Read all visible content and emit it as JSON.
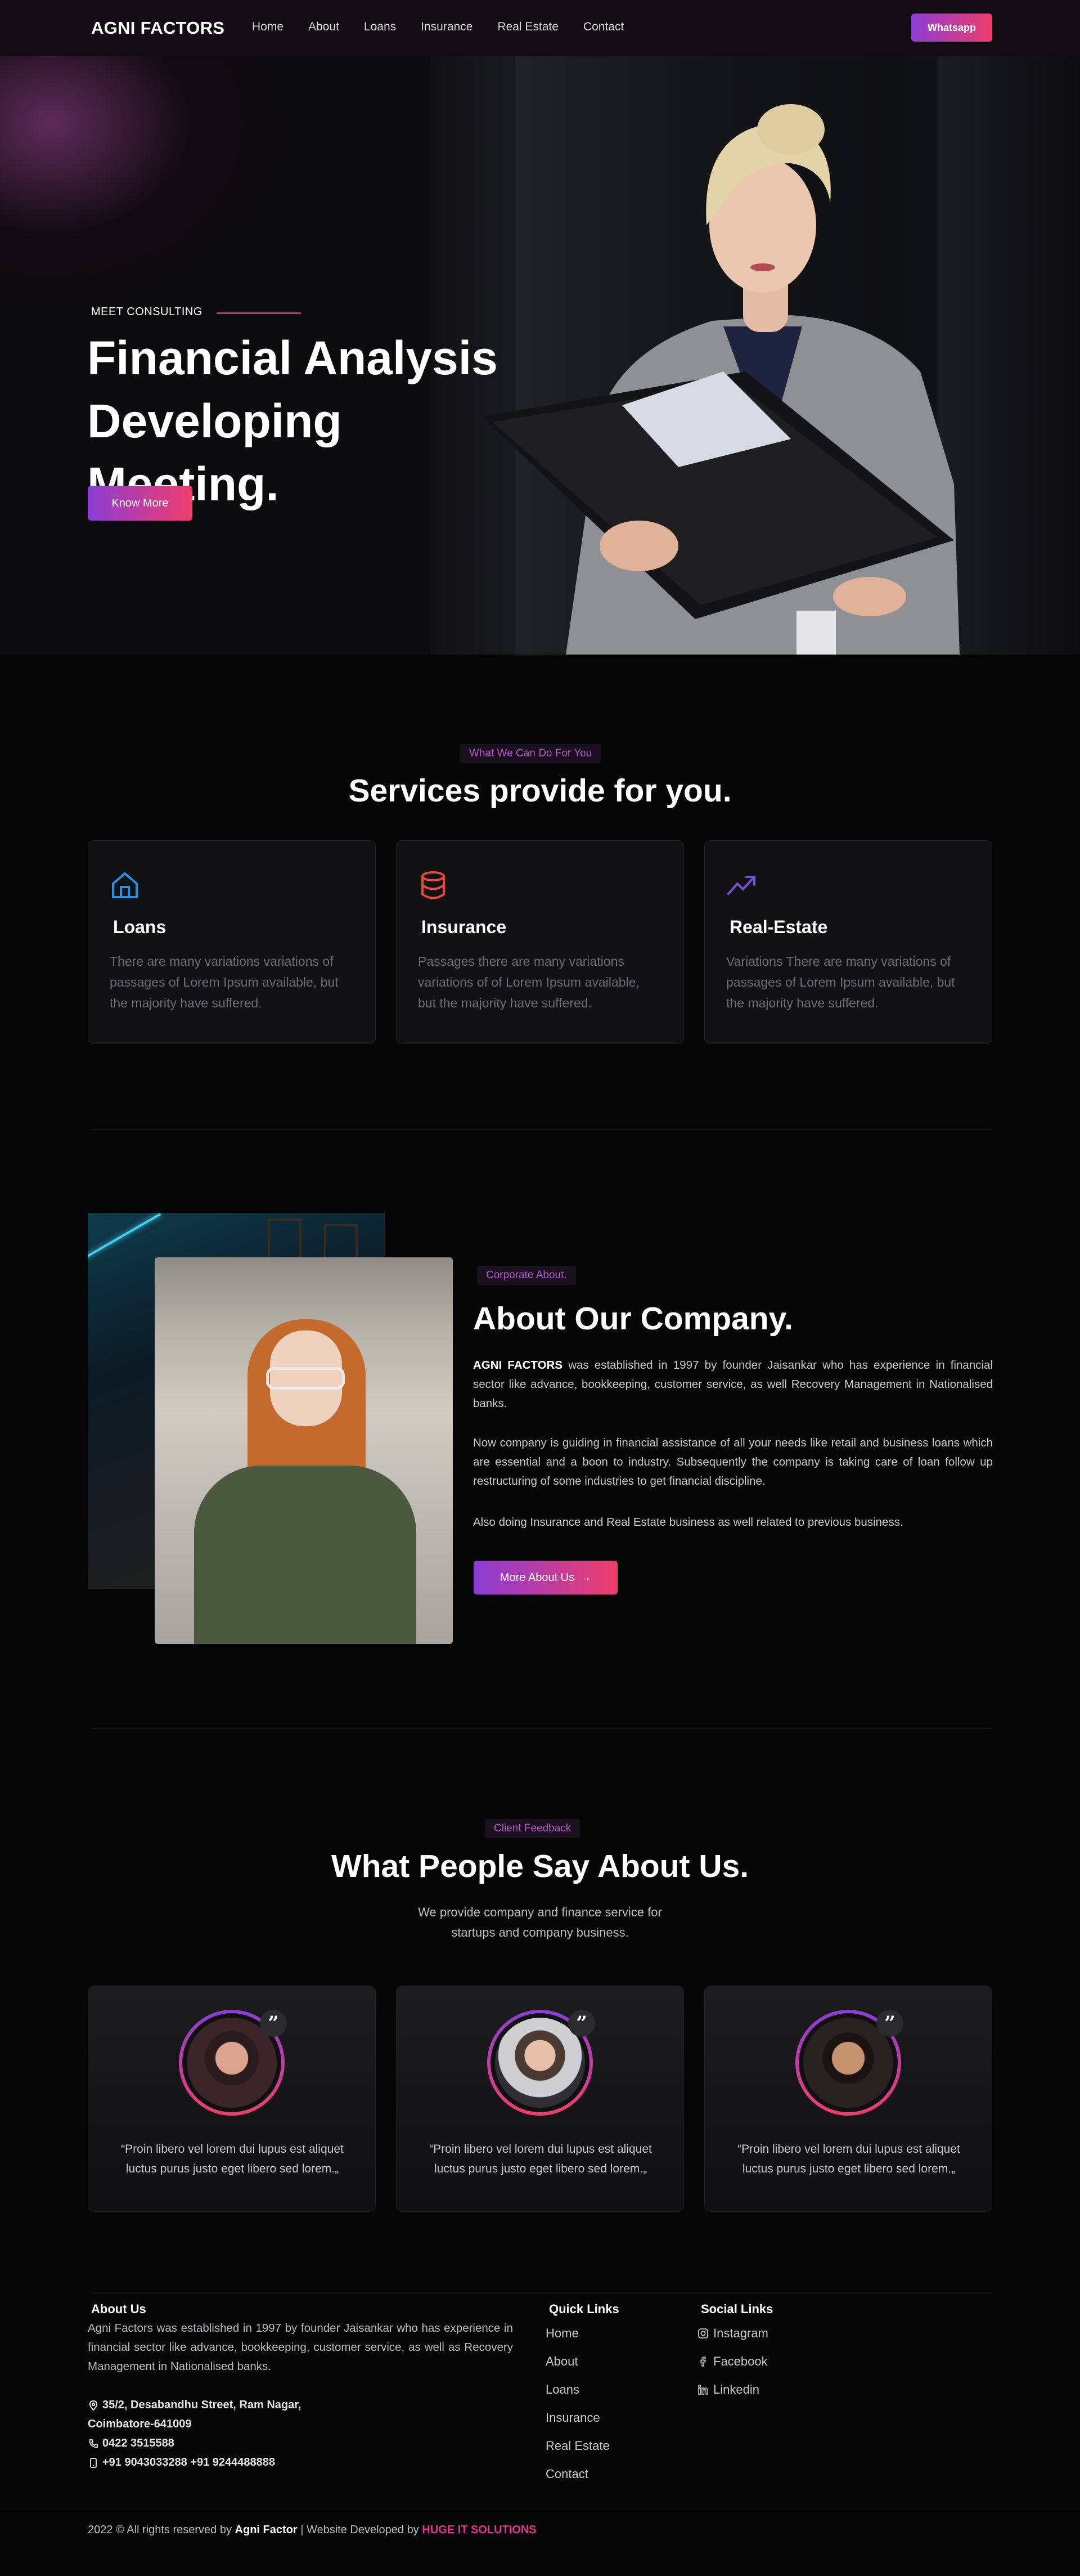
{
  "nav": {
    "logo": "AGNI FACTORS",
    "items": [
      "Home",
      "About",
      "Loans",
      "Insurance",
      "Real Estate",
      "Contact"
    ],
    "cta": "Whatsapp"
  },
  "hero": {
    "eyebrow": "MEET CONSULTING",
    "title_line1": "Financial Analysis",
    "title_line2": "Developing Meeting.",
    "button": "Know More"
  },
  "services": {
    "tag": "What We Can Do For You",
    "title": "Services provide for you.",
    "cards": [
      {
        "icon": "home-icon",
        "title": "Loans",
        "text": "There are many variations variations of passages of Lorem Ipsum available, but the majority have suffered."
      },
      {
        "icon": "database-icon",
        "title": "Insurance",
        "text": "Passages there are many variations variations of of Lorem Ipsum available, but the majority have suffered."
      },
      {
        "icon": "trending-up-icon",
        "title": "Real-Estate",
        "text": "Variations There are many variations of passages of Lorem Ipsum available, but the majority have suffered."
      }
    ]
  },
  "about": {
    "tag": "Corporate About.",
    "title": "About Our Company.",
    "p1_bold": "AGNI FACTORS",
    "p1_rest": " was established in 1997 by founder Jaisankar who has experience in financial sector like advance, bookkeeping, customer service, as well Recovery Management in Nationalised banks.",
    "p2": "Now company is guiding in financial assistance of all your needs like retail and business loans which are essential and a boon to industry. Subsequently the company is taking care of loan follow up restructuring of some industries to get financial discipline.",
    "p3": "Also doing Insurance and Real Estate business as well related to previous business.",
    "button": "More About Us",
    "button_icon": "→"
  },
  "testimonials": {
    "tag": "Client Feedback",
    "title": "What People Say About Us.",
    "subtitle_line1": "We provide company and finance service for",
    "subtitle_line2": "startups and company business.",
    "quote_mark": "”",
    "items": [
      {
        "quote": "“Proin libero vel lorem dui lupus est aliquet luctus purus justo eget libero sed lorem.„"
      },
      {
        "quote": "“Proin libero vel lorem dui lupus est aliquet luctus purus justo eget libero sed lorem.„"
      },
      {
        "quote": "“Proin libero vel lorem dui lupus est aliquet luctus purus justo eget libero sed lorem.„"
      }
    ]
  },
  "footer": {
    "about_head": "About Us",
    "about_text": "Agni Factors was established in 1997 by founder Jaisankar who has experience in financial sector like advance, bookkeeping, customer service, as well as Recovery Management in Nationalised banks.",
    "address_line1": "35/2, Desabandhu Street, Ram Nagar,",
    "address_line2": "Coimbatore-641009",
    "phone": "0422 3515588",
    "mobile": "+91 9043033288 +91 9244488888",
    "quick_head": "Quick Links",
    "quick_links": [
      "Home",
      "About",
      "Loans",
      "Insurance",
      "Real Estate",
      "Contact"
    ],
    "social_head": "Social Links",
    "social_links": [
      "Instagram",
      "Facebook",
      "Linkedin"
    ],
    "copyright_pre": "2022 © All rights reserved by ",
    "copyright_name": "Agni Factor",
    "copyright_mid": " | Website Developed by ",
    "copyright_brand": "HUGE IT SOLUTIONS"
  }
}
